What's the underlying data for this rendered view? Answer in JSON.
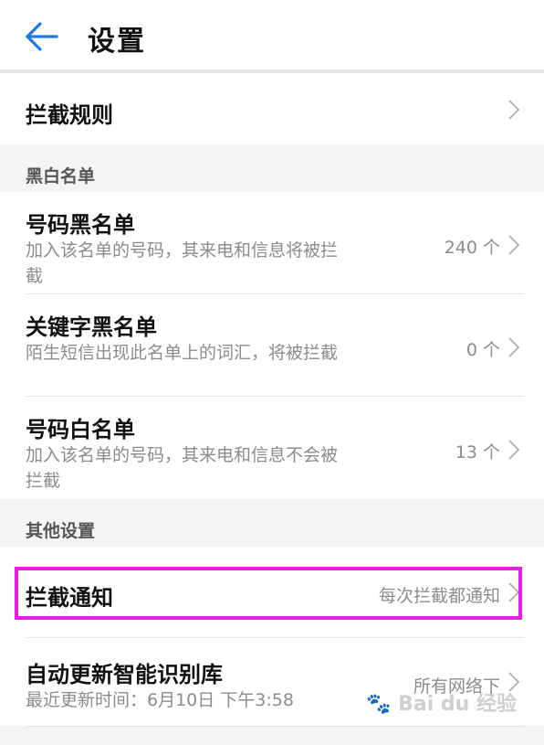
{
  "header": {
    "title": "设置",
    "back_icon": "arrow-left-icon",
    "accent_color": "#1f7ae0"
  },
  "rows": {
    "intercept_rules": {
      "title": "拦截规则"
    },
    "number_blacklist": {
      "title": "号码黑名单",
      "subtitle": "加入该名单的号码，其来电和信息将被拦截",
      "value": "240 个"
    },
    "keyword_blacklist": {
      "title": "关键字黑名单",
      "subtitle": "陌生短信出现此名单上的词汇，将被拦截",
      "value": "0 个"
    },
    "number_whitelist": {
      "title": "号码白名单",
      "subtitle": "加入该名单的号码，其来电和信息不会被拦截",
      "value": "13 个"
    },
    "intercept_notification": {
      "title": "拦截通知",
      "value": "每次拦截都通知"
    },
    "auto_update": {
      "title": "自动更新智能识别库",
      "subtitle": "最近更新时间：6月10日 下午3:58",
      "value": "所有网络下"
    }
  },
  "sections": {
    "blackwhite": "黑白名单",
    "other": "其他设置"
  },
  "highlight_color": "#e61fe6",
  "watermark": {
    "text": "Bai du 经验",
    "icon": "paw-logo-icon"
  }
}
